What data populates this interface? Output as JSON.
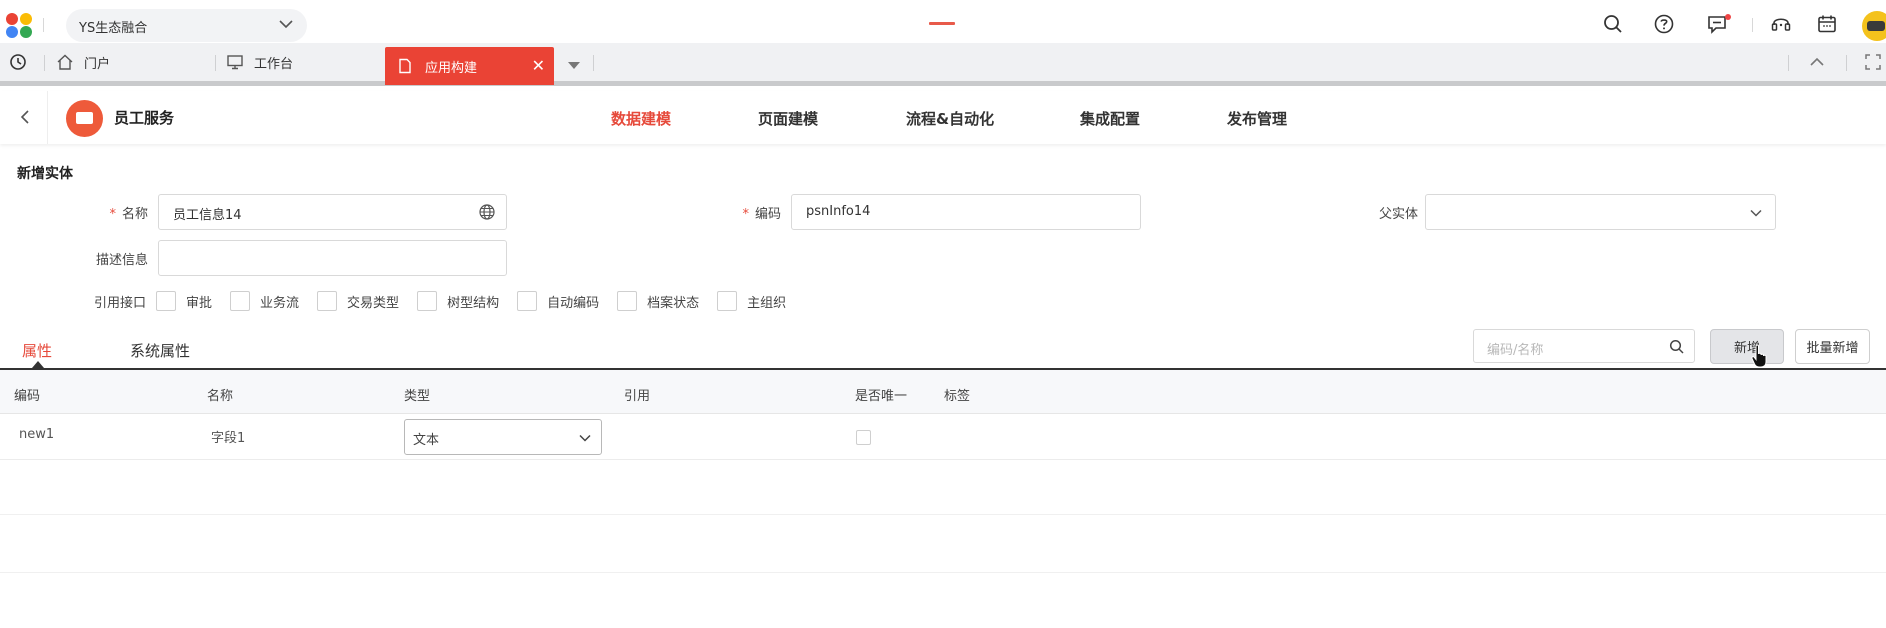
{
  "header": {
    "workspace": "YS生态融合",
    "icons": [
      "search-icon",
      "help-icon",
      "message-icon",
      "headset-icon",
      "calendar-icon",
      "avatar"
    ]
  },
  "tabs": {
    "items": [
      {
        "label": "门户",
        "icon": "home-icon"
      },
      {
        "label": "工作台",
        "icon": "monitor-icon"
      }
    ],
    "active": {
      "label": "应用构建",
      "icon": "document-icon"
    }
  },
  "appnav": {
    "title": "员工服务",
    "items": [
      "数据建模",
      "页面建模",
      "流程&自动化",
      "集成配置",
      "发布管理"
    ],
    "active_index": 0
  },
  "form": {
    "section_title": "新增实体",
    "name_label": "名称",
    "name_value": "员工信息14",
    "code_label": "编码",
    "code_value": "psnInfo14",
    "parent_label": "父实体",
    "parent_value": "",
    "desc_label": "描述信息",
    "desc_value": "",
    "interfaces_label": "引用接口",
    "interfaces": [
      "审批",
      "业务流",
      "交易类型",
      "树型结构",
      "自动编码",
      "档案状态",
      "主组织"
    ]
  },
  "subtabs": {
    "items": [
      "属性",
      "系统属性"
    ],
    "active_index": 0
  },
  "toolbar": {
    "search_placeholder": "编码/名称",
    "add_label": "新增",
    "batch_add_label": "批量新增"
  },
  "table": {
    "columns": [
      "编码",
      "名称",
      "类型",
      "引用",
      "是否唯一",
      "标签"
    ],
    "rows": [
      {
        "code": "new1",
        "name": "字段1",
        "type": "文本",
        "ref": "",
        "unique": false,
        "tag": ""
      }
    ]
  },
  "colors": {
    "accent": "#e64a3b",
    "active_tab": "#ea4335"
  }
}
